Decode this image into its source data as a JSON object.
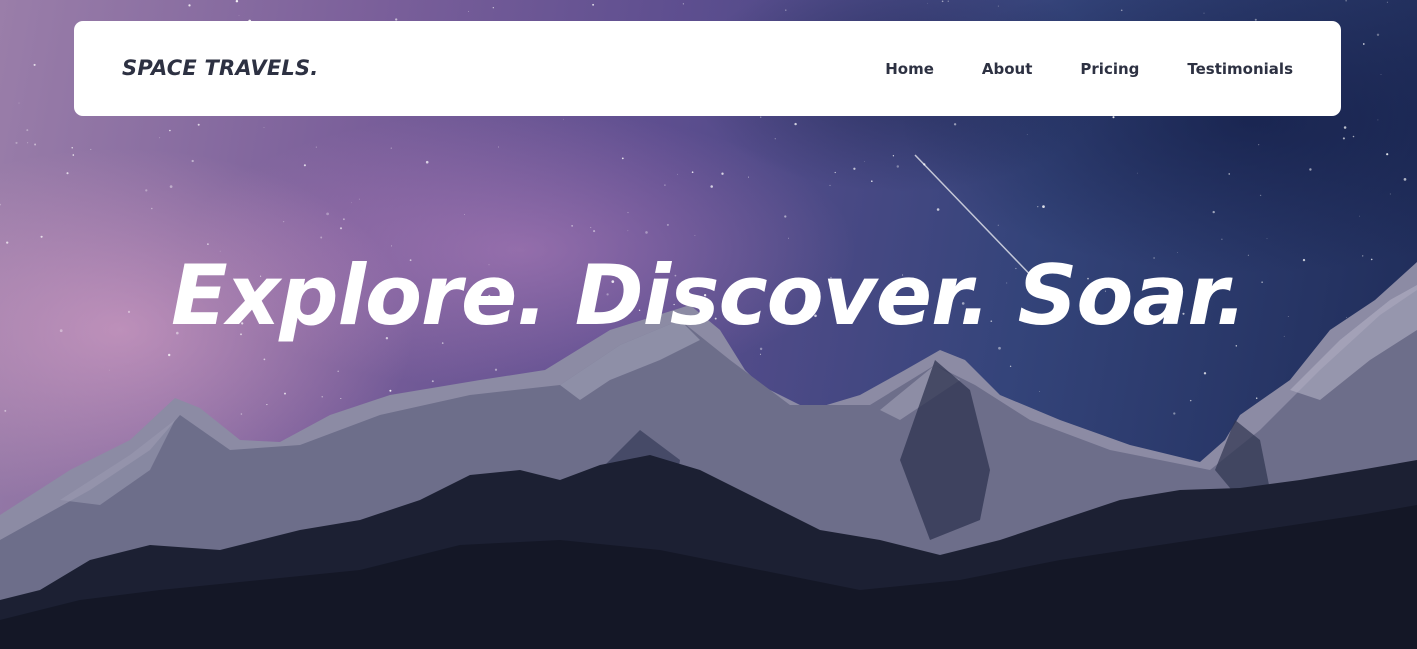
{
  "navbar": {
    "brand": "SPACE TRAVELS.",
    "links": [
      {
        "label": "Home"
      },
      {
        "label": "About"
      },
      {
        "label": "Pricing"
      },
      {
        "label": "Testimonials"
      }
    ]
  },
  "hero": {
    "headline": "Explore. Discover. Soar."
  },
  "colors": {
    "nav_background": "#ffffff",
    "nav_text": "#2d3142",
    "headline_text": "#ffffff"
  }
}
